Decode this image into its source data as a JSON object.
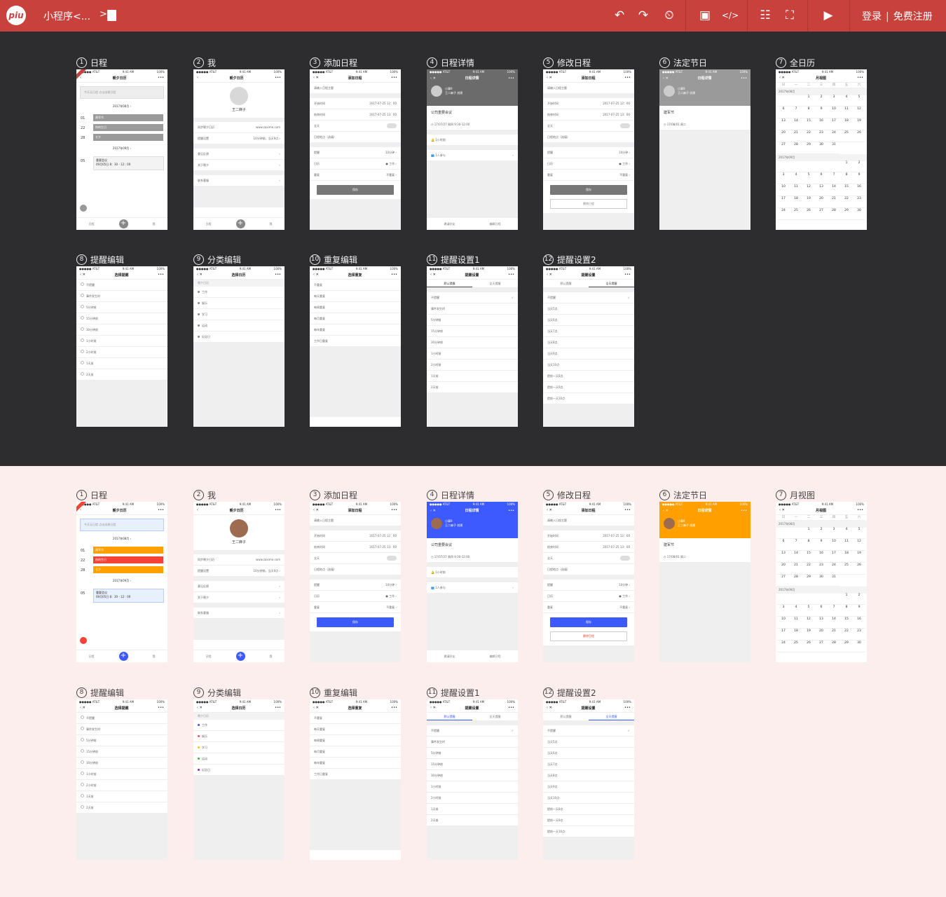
{
  "topbar": {
    "logo": "piu",
    "title": "小程序<...",
    "crumb": ">",
    "login": "登录",
    "divider": "|",
    "register": "免费注册",
    "icons": [
      "undo-icon",
      "redo-icon",
      "history-icon",
      "save-icon",
      "code-icon",
      "layout-icon",
      "fullscreen-icon",
      "play-icon"
    ]
  },
  "colors": {
    "topbar": "#c9413c",
    "dark_bg": "#2d2d30",
    "light_bg": "#fdeeee",
    "blue": "#3d5afe",
    "orange": "#ffa000",
    "red": "#f44336",
    "gray_accent": "#8a8a8a",
    "gray_header": "#666666"
  },
  "labels_dark": [
    {
      "n": "1",
      "t": "日程"
    },
    {
      "n": "2",
      "t": "我"
    },
    {
      "n": "3",
      "t": "添加日程"
    },
    {
      "n": "4",
      "t": "日程详情"
    },
    {
      "n": "5",
      "t": "修改日程"
    },
    {
      "n": "6",
      "t": "法定节日"
    },
    {
      "n": "7",
      "t": "全日历"
    },
    {
      "n": "8",
      "t": "提醒编辑"
    },
    {
      "n": "9",
      "t": "分类编辑"
    },
    {
      "n": "10",
      "t": "重复编辑"
    },
    {
      "n": "11",
      "t": "提醒设置1"
    },
    {
      "n": "12",
      "t": "提醒设置2"
    }
  ],
  "labels_light": [
    {
      "n": "1",
      "t": "日程"
    },
    {
      "n": "2",
      "t": "我"
    },
    {
      "n": "3",
      "t": "添加日程"
    },
    {
      "n": "4",
      "t": "日程详情"
    },
    {
      "n": "5",
      "t": "修改日程"
    },
    {
      "n": "6",
      "t": "法定节日"
    },
    {
      "n": "7",
      "t": "月视图"
    },
    {
      "n": "8",
      "t": "提醒编辑"
    },
    {
      "n": "9",
      "t": "分类编辑"
    },
    {
      "n": "10",
      "t": "重复编辑"
    },
    {
      "n": "11",
      "t": "提醒设置1"
    },
    {
      "n": "12",
      "t": "提醒设置2"
    }
  ],
  "status": {
    "carrier": "●●●●● AT&T",
    "time": "9:41 AM",
    "battery": "100%"
  },
  "p1": {
    "title": "朝夕日历",
    "placeholder": "今天无日程 点击创建日程",
    "month1": "2017年08月",
    "days": [
      "01",
      "22",
      "28"
    ],
    "events": [
      "建军节",
      "你的生日",
      "七夕"
    ],
    "month2": "2017年09月",
    "day3": "05",
    "ev3": "重要会议",
    "ev3t": "09月05日 8：30 - 12：00",
    "tab_left": "日程",
    "tab_right": "我"
  },
  "p2": {
    "title": "朝夕日历",
    "name": "王二麻子",
    "rows": [
      "同步朝夕日历",
      "提醒设置",
      "意见反馈",
      "关于朝夕",
      "联系客服"
    ],
    "v0": "www.zaxime.com",
    "v1": "10分钟前，当天9点"
  },
  "p3": {
    "title": "添加日程",
    "ph": "请输入日程主题",
    "rows": [
      "开始时间",
      "结束时间",
      "全天",
      "日程地点（选填）",
      "提醒",
      "日历",
      "重复"
    ],
    "v0": "2017-07-25  12：00",
    "v1": "2017-07-25  13：00",
    "v4": "10分钟",
    "v5": "工作",
    "v6": "不重复",
    "save": "保存"
  },
  "p4": {
    "title": "日程详情",
    "who": "小事9",
    "creator": "王二麻子 创建",
    "evt": "公司重要会议",
    "time": "17/07/27 周四 9:30-12:00",
    "remind": "1小时前",
    "join": "1人参与",
    "invite": "邀请好友",
    "edit": "编辑日程"
  },
  "p5": {
    "title": "添加日程",
    "delete": "删除日程"
  },
  "p6": {
    "title": "日程详情",
    "item": "建军节",
    "date": "17/08/01 周二"
  },
  "p7": {
    "title": "月视图",
    "title_dark": "月视图",
    "week": [
      "日",
      "一",
      "二",
      "三",
      "四",
      "五",
      "六"
    ],
    "m1": "2017年08月",
    "m2": "2017年09月"
  },
  "p8": {
    "title": "选择提醒",
    "rows": [
      "不提醒",
      "事件发生时",
      "5分钟前",
      "15分钟前",
      "30分钟前",
      "1小时前",
      "2小时前",
      "1天前",
      "2天前"
    ]
  },
  "p9": {
    "title": "选择日历",
    "head": "朝夕日历",
    "rows": [
      "工作",
      "娱乐",
      "学习",
      "运动",
      "纪念日"
    ]
  },
  "p10": {
    "title": "选择重复",
    "rows": [
      "不重复",
      "每天重复",
      "每周重复",
      "每月重复",
      "每年重复",
      "工作日重复"
    ]
  },
  "p11": {
    "title": "提醒设置",
    "tabs": [
      "默认提醒",
      "全天提醒"
    ],
    "rows": [
      "不提醒",
      "事件发生时",
      "5分钟前",
      "15分钟前",
      "30分钟前",
      "1小时前",
      "2小时前",
      "1天前",
      "2天前"
    ]
  },
  "p12": {
    "title": "提醒设置",
    "tabs": [
      "默认提醒",
      "全天提醒"
    ],
    "rows": [
      "不提醒",
      "当天5点",
      "当天6点",
      "当天7点",
      "当天8点",
      "当天9点",
      "当天10点",
      "提前一天8点",
      "提前一天9点",
      "提前一天10点"
    ]
  }
}
